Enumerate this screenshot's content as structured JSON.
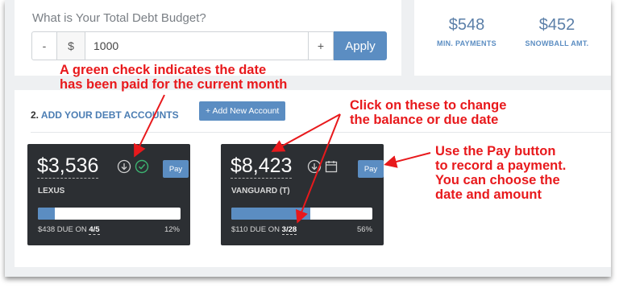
{
  "budget": {
    "title": "What is Your Total Debt Budget?",
    "minus_label": "-",
    "currency": "$",
    "value": "1000",
    "plus_label": "+",
    "apply_label": "Apply"
  },
  "stats": [
    {
      "value": "$548",
      "label": "MIN. PAYMENTS"
    },
    {
      "value": "$452",
      "label": "SNOWBALL AMT."
    }
  ],
  "debts_section": {
    "number": "2.",
    "title": "ADD YOUR DEBT ACCOUNTS",
    "add_button_label": "+ Add New Account"
  },
  "accounts": [
    {
      "amount": "$3,536",
      "name": "LEXUS",
      "pay_label": "Pay",
      "due_prefix": "$438 DUE ON",
      "due_date": "4/5",
      "percent": "12%",
      "progress": 0.12,
      "paid": true
    },
    {
      "amount": "$8,423",
      "name": "VANGUARD (T)",
      "pay_label": "Pay",
      "due_prefix": "$110 DUE ON",
      "due_date": "3/28",
      "percent": "56%",
      "progress": 0.56,
      "paid": false
    }
  ],
  "annotations": {
    "green_check": [
      "A green check indicates the date",
      "has been paid for the current month"
    ],
    "click_change": [
      "Click on these to change",
      "the balance or due date"
    ],
    "pay_button": [
      "Use the Pay button",
      "to record a payment.",
      "You can choose the",
      "date and amount"
    ]
  },
  "colors": {
    "accent": "#5b8dc2",
    "annotation": "#e8191c",
    "card": "#2c2f33",
    "paid_check": "#3cb371"
  }
}
